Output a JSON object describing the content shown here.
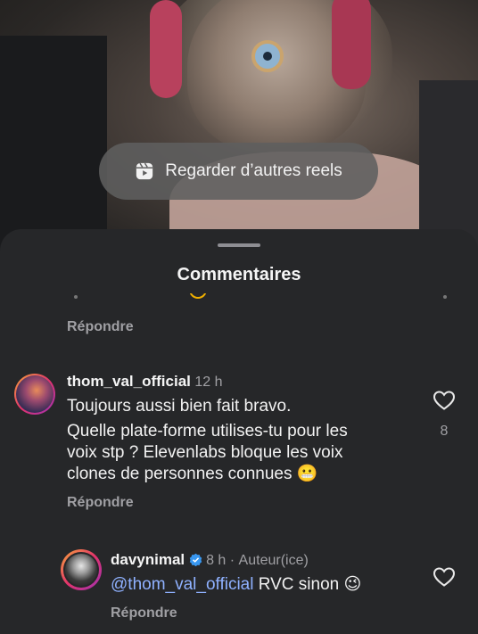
{
  "reels_button": {
    "label": "Regarder d’autres reels",
    "icon": "reels-icon"
  },
  "sheet": {
    "title": "Commentaires"
  },
  "previous_comment": {
    "reply_label": "Répondre"
  },
  "comments": [
    {
      "username": "thom_val_official",
      "time": "12 h",
      "text_line1": "Toujours aussi bien fait bravo.",
      "text_line2": "Quelle plate-forme utilises-tu pour les",
      "text_line3": "voix stp ? Elevenlabs bloque les voix",
      "text_line4": "clones de personnes connues",
      "emoji": "😬",
      "likes": "8",
      "reply_label": "Répondre"
    },
    {
      "username": "davynimal",
      "verified": true,
      "time": "8 h",
      "separator": "·",
      "author_tag": "Auteur(ice)",
      "mention": "@thom_val_official",
      "text": "RVC sinon",
      "emoji": "😉",
      "reply_label": "Répondre"
    }
  ],
  "colors": {
    "sheet_bg": "#262729",
    "mention": "#8fb1ff",
    "muted": "#a0a0a4",
    "verified": "#3897f0"
  }
}
